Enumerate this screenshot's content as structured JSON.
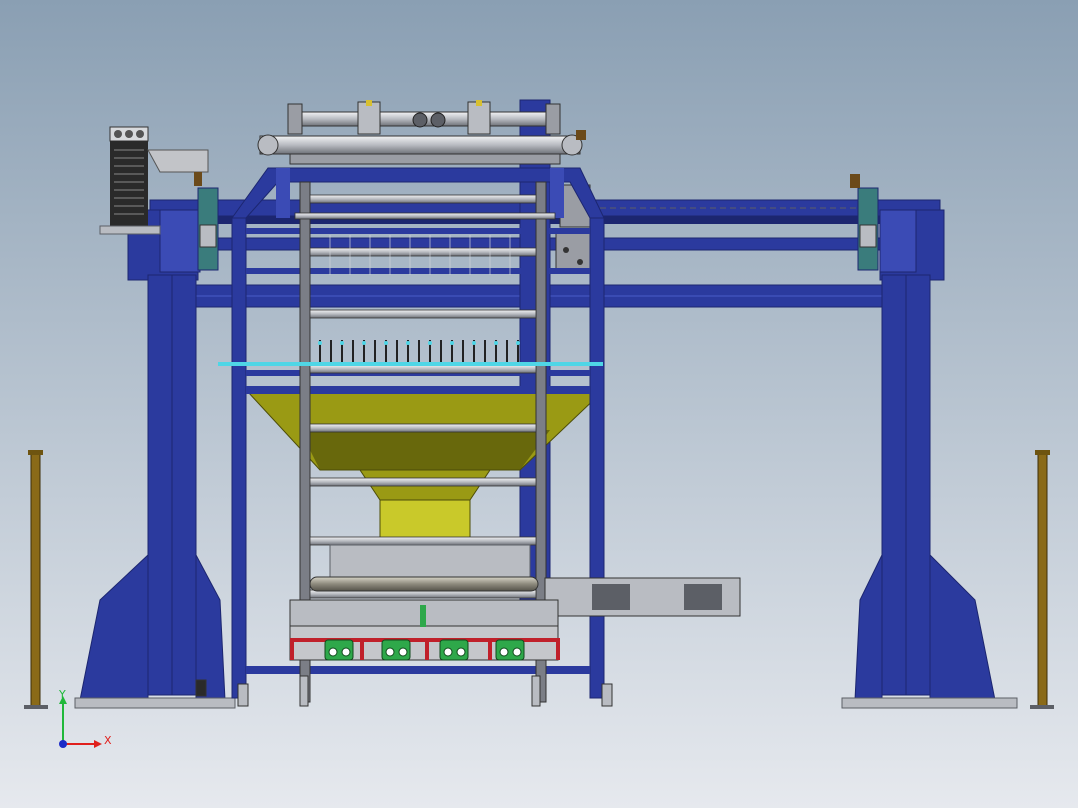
{
  "viewport": {
    "background_top": "#8a9fb3",
    "background_bottom": "#e6e9ee"
  },
  "colors": {
    "frame_blue": "#2b3a9e",
    "frame_blue_dark": "#1c2670",
    "frame_blue_light": "#4a5cc8",
    "hopper_yellow": "#9a9a14",
    "hopper_yellow_light": "#c9c92a",
    "hopper_dark": "#4d4d08",
    "steel": "#b9bcc2",
    "steel_dark": "#5c5f66",
    "bronze": "#8a6a18",
    "cyan": "#4fd6e6",
    "green": "#2ea84a",
    "red": "#c0202a"
  },
  "triad": {
    "x_label": "X",
    "y_label": "Y",
    "x_color": "#e0201c",
    "y_color": "#20b83a",
    "origin_color": "#1c2cc8"
  }
}
